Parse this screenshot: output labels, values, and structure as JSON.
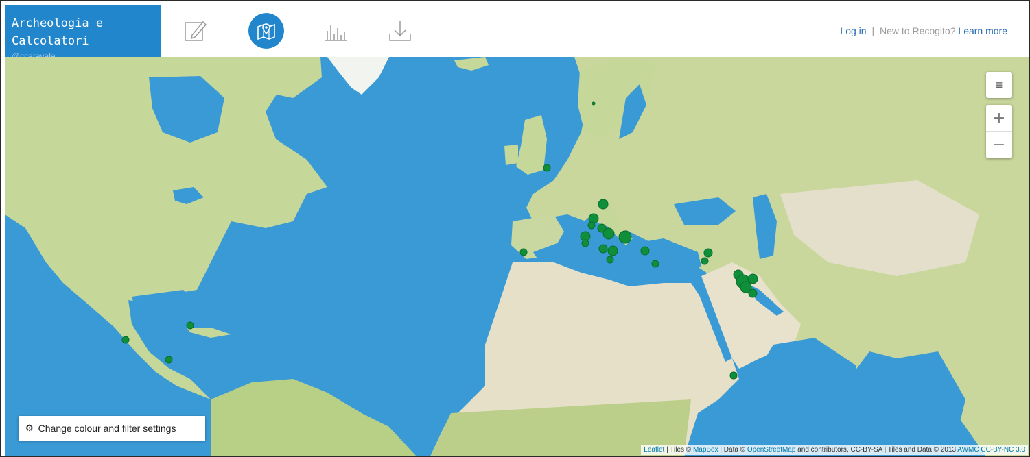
{
  "brand": {
    "title": "Archeologia e\nCalcolatori",
    "user": "@ccaravale"
  },
  "nav": {
    "items": [
      {
        "name": "edit-icon",
        "active": false
      },
      {
        "name": "map-icon",
        "active": true
      },
      {
        "name": "stats-icon",
        "active": false
      },
      {
        "name": "download-icon",
        "active": false
      }
    ]
  },
  "auth": {
    "login": "Log in",
    "separator": "|",
    "new_text": "New to Recogito?",
    "learn_more": "Learn more"
  },
  "map": {
    "layers_icon": "hamburger-icon",
    "zoom_in": "+",
    "zoom_out": "−",
    "settings_label": "Change colour and filter settings",
    "attribution": {
      "leaflet": "Leaflet",
      "sep1": " | Tiles © ",
      "mapbox": "MapBox",
      "sep2": " | Data © ",
      "osm": "OpenStreetMap",
      "rest": " and contributors, CC-BY-SA | Tiles and Data © 2013 ",
      "awmc": "AWMC CC-BY-NC 3.0"
    }
  },
  "colors": {
    "accent": "#2286cc",
    "ocean": "#3a9ad6",
    "land": "#cfd9a0",
    "marker": "#0f8f3a",
    "link": "#2a6fb3"
  }
}
